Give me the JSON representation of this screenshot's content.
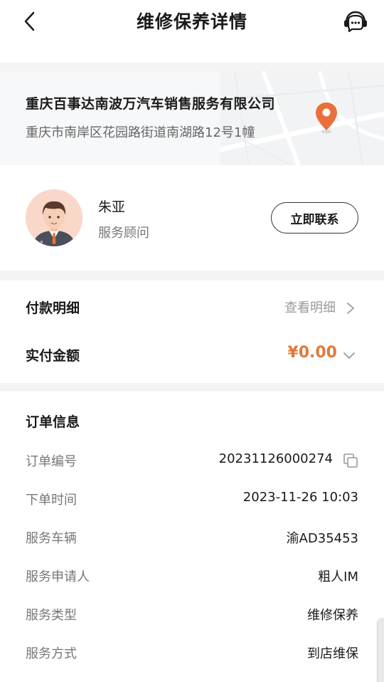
{
  "header": {
    "title": "维修保养详情",
    "back_icon": "chevron-left-icon",
    "support_icon": "customer-service-icon"
  },
  "dealer": {
    "name": "重庆百事达南波万汽车销售服务有限公司",
    "address": "重庆市南岸区花园路街道南湖路12号1幢",
    "pin_icon": "location-pin-icon",
    "pin_color": "#e8703a"
  },
  "advisor": {
    "name": "朱亚",
    "role": "服务顾问",
    "contact_label": "立即联系"
  },
  "payment": {
    "detail_label": "付款明细",
    "detail_link": "查看明细",
    "paid_label": "实付金额",
    "paid_amount": "¥0.00",
    "amount_color": "#e07a3b"
  },
  "order": {
    "title": "订单信息",
    "rows": [
      {
        "label": "订单编号",
        "value": "20231126000274"
      },
      {
        "label": "下单时间",
        "value": "2023-11-26 10:03"
      },
      {
        "label": "服务车辆",
        "value": "渝AD35453"
      },
      {
        "label": "服务申请人",
        "value": "粗人IM"
      },
      {
        "label": "服务类型",
        "value": "维修保养"
      },
      {
        "label": "服务方式",
        "value": "到店维保"
      }
    ]
  }
}
